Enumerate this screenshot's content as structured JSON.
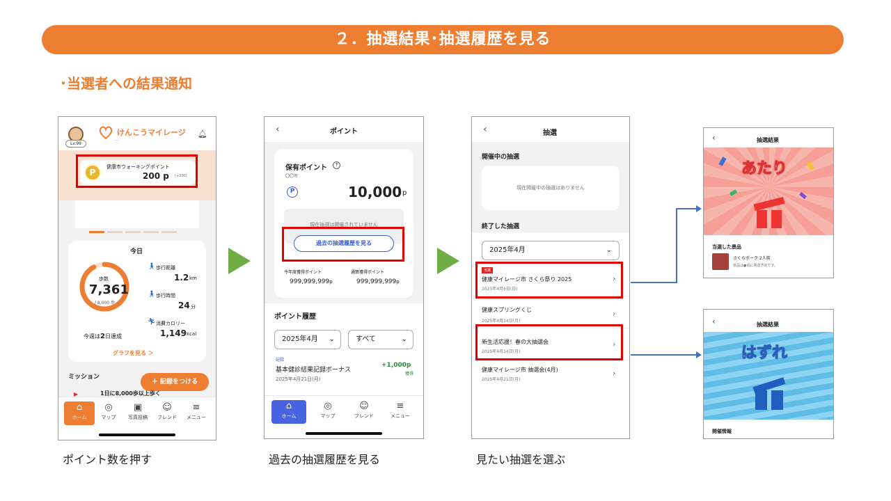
{
  "banner": {
    "title": "２．抽選結果･抽選履歴を見る"
  },
  "subtitle": "･当選者への結果通知",
  "colors": {
    "accent": "#ED7D31",
    "highlight": "#E00000",
    "arrow": "#70AD47",
    "connector": "#4472C4"
  },
  "captions": {
    "step1": "ポイント数を押す",
    "step2": "過去の抽選履歴を見る",
    "step3": "見たい抽選を選ぶ"
  },
  "phone1": {
    "level": "Lv.99",
    "app_name": "けんこうマイレージ",
    "app_name_sub": "...",
    "points_label": "健康市ウォーキングポイント",
    "points_value": "200 p",
    "points_sub": "(+200)",
    "today_title": "今日",
    "steps_label": "歩数",
    "steps_value": "7,361",
    "steps_goal": "/ 8,000 歩",
    "steps_progress": 0.92,
    "distance_label": "歩行距離",
    "distance_value": "1.2",
    "distance_unit": "km",
    "walktime_label": "歩行時間",
    "walktime_value": "24",
    "walktime_unit": "分",
    "calorie_label": "消費カロリー",
    "calorie_value": "1,149",
    "calorie_unit": "kcal",
    "week_text_pre": "今週は",
    "week_days": "2",
    "week_text_post": "日達成",
    "graph_link": "グラフを見る ＞",
    "mission_label": "ミッション",
    "record_button": "＋ 記録をつける",
    "mission_item": "1日に8,000歩以上歩く",
    "nav": [
      "ホーム",
      "マップ",
      "写真投稿",
      "フレンド",
      "メニュー"
    ]
  },
  "phone2": {
    "title": "ポイント",
    "holding_label": "保有ポイント",
    "city": "〇〇市",
    "points": "10,000",
    "points_unit": "p",
    "notice": "現在抽選は開催されていません",
    "history_button": "過去の抽選履歴を見る",
    "year_label": "今年度獲得ポイント",
    "year_value": "999,999,999",
    "total_label": "通算獲得ポイント",
    "total_value": "999,999,999",
    "value_unit": "p",
    "history_title": "ポイント履歴",
    "month_select": "2025年4月",
    "filter_select": "すべて",
    "record_tag": "記録",
    "record_title": "基本健診結果記録ボーナス",
    "record_date": "2025年4月21日(月)",
    "record_points": "+1,000",
    "record_unit": "p",
    "record_status": "獲得",
    "nav": [
      "ホーム",
      "マップ",
      "フレンド",
      "メニュー"
    ]
  },
  "phone3": {
    "title": "抽選",
    "open_label": "開催中の抽選",
    "no_lottery": "現在開催中の抽選はありません",
    "ended_label": "終了した抽選",
    "month_select": "2025年4月",
    "items": [
      {
        "tag": "当選",
        "title": "健康マイレージ市 さくら祭り 2025",
        "date": "2025年4月6日(日)"
      },
      {
        "tag": "",
        "title": "健康スプリングくじ",
        "date": "2025年4月14日(月)"
      },
      {
        "tag": "",
        "title": "新生活応援！春の大抽選会",
        "date": "2025年4月14日(月)"
      },
      {
        "tag": "",
        "title": "健康マイレージ市 抽選会(4月)",
        "date": "2025年4月21日(月)"
      }
    ]
  },
  "result_win": {
    "title": "抽選結果",
    "banner_text": "あたり",
    "prize_label": "当選した景品",
    "prize_name": "さくらポーク 2人前",
    "prize_note": "景品は●頃に発送予定です。"
  },
  "result_lose": {
    "title": "抽選結果",
    "banner_text": "はずれ",
    "info_label": "開催情報"
  }
}
